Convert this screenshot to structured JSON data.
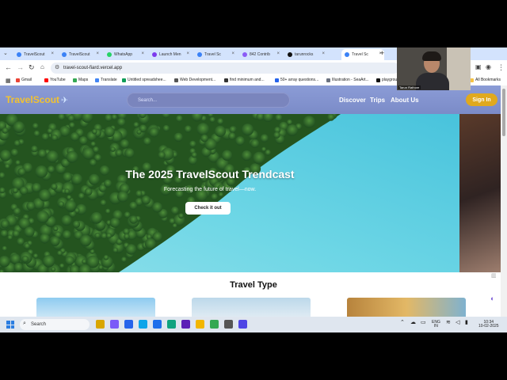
{
  "browser": {
    "tabs": [
      {
        "label": "TravelScout",
        "color": "#3b82f6"
      },
      {
        "label": "TravelScout",
        "color": "#3b82f6"
      },
      {
        "label": "WhatsApp",
        "color": "#25d366"
      },
      {
        "label": "Launch Men",
        "color": "#7c3aed"
      },
      {
        "label": "Travel Sc",
        "color": "#3b82f6"
      },
      {
        "label": "842 Contrib",
        "color": "#8b5cf6"
      },
      {
        "label": "tarunrocks",
        "color": "#111111"
      },
      {
        "label": "Travel Sc",
        "color": "#3b82f6"
      }
    ],
    "url": "travel-scout-fiard.vercel.app",
    "bookmarks": [
      {
        "label": "Gmail",
        "color": "#ea4335"
      },
      {
        "label": "YouTube",
        "color": "#ff0000"
      },
      {
        "label": "Maps",
        "color": "#34a853"
      },
      {
        "label": "Translate",
        "color": "#4285f4"
      },
      {
        "label": "Untitled spreadshee...",
        "color": "#0f9d58"
      },
      {
        "label": "Web Development...",
        "color": "#555555"
      },
      {
        "label": "find minimum and...",
        "color": "#333333"
      },
      {
        "label": "50+ array questions...",
        "color": "#2563eb"
      },
      {
        "label": "Illustration - SeaArt...",
        "color": "#6b7280"
      },
      {
        "label": "playgrou",
        "color": "#111111"
      }
    ],
    "all_bookmarks": "All Bookmarks"
  },
  "webcam": {
    "name": "Tarun Rathore"
  },
  "site": {
    "logo": "TravelScout",
    "search_placeholder": "Search...",
    "nav": [
      "Discover",
      "Trips",
      "About Us"
    ],
    "signin": "Sign In",
    "hero_title": "The 2025 TravelScout Trendcast",
    "hero_subtitle": "Forecasting the future of travel—now.",
    "hero_button": "Check it out",
    "section_title": "Travel Type"
  },
  "taskbar": {
    "search": "Search",
    "lang_top": "ENG",
    "lang_bottom": "IN",
    "time": "10:34",
    "date": "10-02-2025"
  }
}
